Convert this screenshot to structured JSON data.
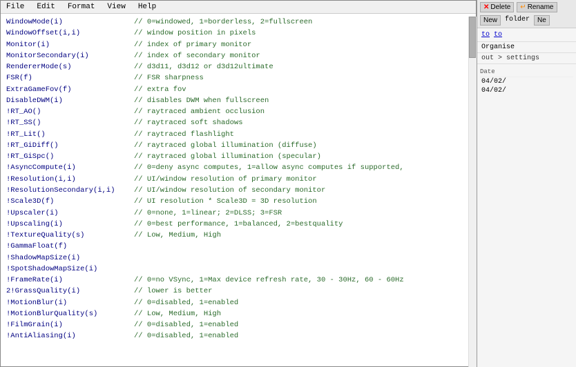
{
  "menu": {
    "items": [
      "File",
      "Edit",
      "Format",
      "View",
      "Help"
    ]
  },
  "code": {
    "lines": [
      {
        "key": "WindowMode(i)",
        "comment": "// 0=windowed, 1=borderless, 2=fullscreen"
      },
      {
        "key": "WindowOffset(i,i)",
        "comment": "// window position in pixels"
      },
      {
        "key": "Monitor(i)",
        "comment": "// index of primary monitor"
      },
      {
        "key": "MonitorSecondary(i)",
        "comment": "// index of secondary monitor"
      },
      {
        "key": "RendererMode(s)",
        "comment": "// d3d11, d3d12 or d3d12ultimate"
      },
      {
        "key": "FSR(f)",
        "comment": "// FSR sharpness"
      },
      {
        "key": "ExtraGameFov(f)",
        "comment": "// extra fov"
      },
      {
        "key": "DisableDWM(i)",
        "comment": "// disables DWM when fullscreen"
      },
      {
        "key": "!RT_AO()",
        "comment": "// raytraced ambient occlusion"
      },
      {
        "key": "!RT_SS()",
        "comment": "// raytraced soft shadows"
      },
      {
        "key": "!RT_Lit()",
        "comment": "// raytraced flashlight"
      },
      {
        "key": "!RT_GiDiff()",
        "comment": "// raytraced global illumination (diffuse)"
      },
      {
        "key": "!RT_GiSpc()",
        "comment": "// raytraced global illumination (specular)"
      },
      {
        "key": "!AsyncCompute(i)",
        "comment": "// 0=deny async computes, 1=allow async computes if supported,"
      },
      {
        "key": "!Resolution(i,i)",
        "comment": "// UI/window resolution of primary monitor"
      },
      {
        "key": "!ResolutionSecondary(i,i)",
        "comment": "// UI/window resolution of secondary monitor"
      },
      {
        "key": "!Scale3D(f)",
        "comment": "// UI resolution * Scale3D = 3D resolution"
      },
      {
        "key": "!Upscaler(i)",
        "comment": "// 0=none, 1=linear; 2=DLSS; 3=FSR"
      },
      {
        "key": "!Upscaling(i)",
        "comment": "// 0=best performance, 1=balanced, 2=bestquality"
      },
      {
        "key": "!TextureQuality(s)",
        "comment": "// Low, Medium, High"
      },
      {
        "key": "!GammaFloat(f)",
        "comment": ""
      },
      {
        "key": "!ShadowMapSize(i)",
        "comment": ""
      },
      {
        "key": "!SpotShadowMapSize(i)",
        "comment": ""
      },
      {
        "key": "!FrameRate(i)",
        "comment": "// 0=no VSync, 1=Max device refresh rate, 30 - 30Hz, 60 - 60Hz"
      },
      {
        "key": "2!GrassQuality(i)",
        "comment": "// lower is better"
      },
      {
        "key": "!MotionBlur(i)",
        "comment": "// 0=disabled, 1=enabled"
      },
      {
        "key": "!MotionBlurQuality(s)",
        "comment": "// Low, Medium, High"
      },
      {
        "key": "!FilmGrain(i)",
        "comment": "// 0=disabled, 1=enabled"
      },
      {
        "key": "!AntiAliasing(i)",
        "comment": "// 0=disabled, 1=enabled"
      }
    ]
  },
  "file_panel": {
    "toolbar": {
      "delete_label": "Delete",
      "rename_label": "Rename",
      "new_label": "New",
      "folder_label": "folder",
      "ne_label": "Ne"
    },
    "nav": {
      "to_label": "to",
      "to2_label": "to"
    },
    "organise_label": "Organise",
    "path": "out > settings",
    "date_headers": [
      "Date",
      "04/02/",
      "04/02/"
    ],
    "items": []
  },
  "scrollbar": {
    "visible": true
  }
}
